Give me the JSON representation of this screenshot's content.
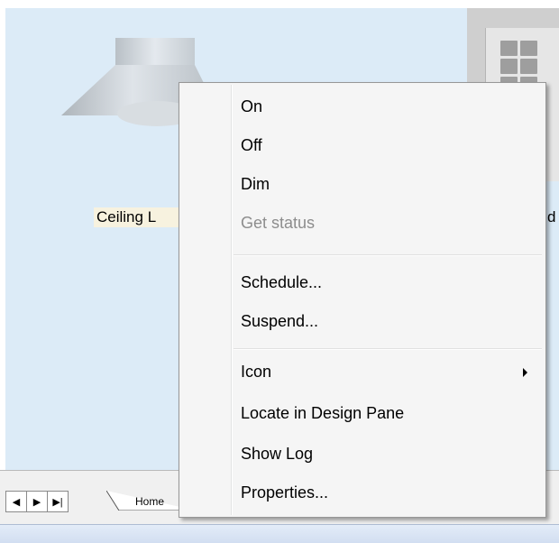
{
  "devices": {
    "left_label": "Ceiling L",
    "right_label": "d"
  },
  "context_menu": {
    "items": [
      {
        "label": "On",
        "enabled": true
      },
      {
        "label": "Off",
        "enabled": true
      },
      {
        "label": "Dim",
        "enabled": true
      },
      {
        "label": "Get status",
        "enabled": false
      },
      {
        "label": "Schedule...",
        "enabled": true
      },
      {
        "label": "Suspend...",
        "enabled": true
      },
      {
        "label": "Icon",
        "enabled": true,
        "has_submenu": true
      },
      {
        "label": "Locate in Design Pane",
        "enabled": true
      },
      {
        "label": "Show Log",
        "enabled": true
      },
      {
        "label": "Properties...",
        "enabled": true
      }
    ]
  },
  "tabs": {
    "nav_icons": [
      "prev-arrow-icon",
      "next-arrow-icon",
      "last-arrow-icon"
    ],
    "home_label": "Home"
  },
  "colors": {
    "pane_background": "#dcebf7",
    "menu_background": "#f5f5f5",
    "disabled_text": "#8d8d8d"
  }
}
